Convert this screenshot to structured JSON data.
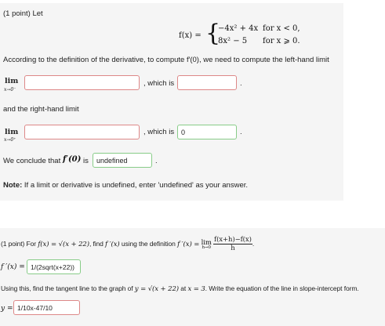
{
  "problem1": {
    "header": "(1 point) Let",
    "piecewise": {
      "lhs": "f(x) =",
      "case1_expr": "−4x² + 4x",
      "case1_cond": "for x < 0,",
      "case2_expr": "8x² − 5",
      "case2_cond": "for x ⩾ 0."
    },
    "intro": "According to the definition of the derivative, to compute f′(0), we need to compute the left-hand limit",
    "left_limit": {
      "lim": "lim",
      "sub": "x→0⁻",
      "input_value": "",
      "which_is": ", which is",
      "result_value": "",
      "trail": "."
    },
    "right_text": "and the right-hand limit",
    "right_limit": {
      "lim": "lim",
      "sub": "x→0⁺",
      "input_value": "",
      "which_is": ", which is",
      "result_value": "0",
      "trail": "."
    },
    "conclude": {
      "text": "We conclude that",
      "fprime": "f′(0)",
      "is": "is",
      "value": "undefined",
      "trail": "."
    },
    "note": {
      "label": "Note:",
      "text": "If a limit or derivative is undefined, enter 'undefined' as your answer."
    }
  },
  "problem2": {
    "statement_a": "(1 point) For",
    "statement_fx": "f(x) = √(x + 22)",
    "statement_b": ", find",
    "statement_fp": "f ′(x)",
    "statement_c": "using the definition",
    "statement_d": "f ′(x) =",
    "lim": "lim",
    "lim_sub": "h→0",
    "frac_num": "f(x+h)−f(x)",
    "frac_den": "h",
    "statement_end": ".",
    "answer_label": "f ′(x) =",
    "answer_value": "1/(2sqrt(x+22))",
    "tangent_a": "Using this, find the tangent line to the graph of",
    "tangent_eq": "y = √(x + 22)",
    "tangent_b": "at",
    "tangent_x": "x = 3",
    "tangent_c": ". Write the equation of the line in slope-intercept form.",
    "y_label": "y =",
    "y_value": "1/10x-47/10"
  }
}
